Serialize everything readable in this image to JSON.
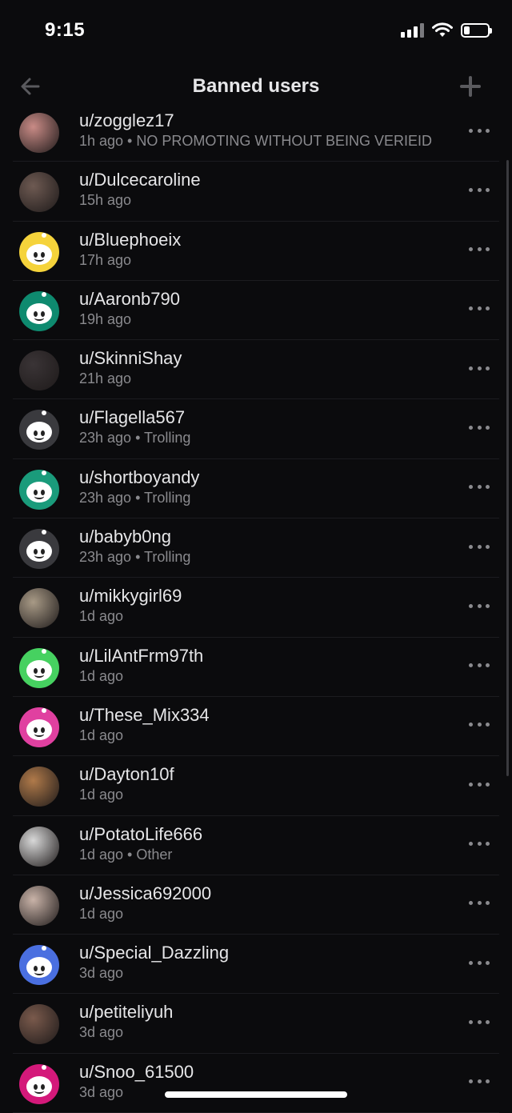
{
  "status": {
    "time": "9:15"
  },
  "header": {
    "title": "Banned users",
    "back_icon": "arrow-left-icon",
    "add_icon": "plus-icon"
  },
  "users": [
    {
      "name": "u/zogglez17",
      "meta": "1h ago • NO PROMOTING WITHOUT BEING VERIEID",
      "avatar": "photo",
      "color": "#c98b86"
    },
    {
      "name": "u/Dulcecaroline",
      "meta": "15h ago",
      "avatar": "photo",
      "color": "#6e5a52"
    },
    {
      "name": "u/Bluephoeix",
      "meta": "17h ago",
      "avatar": "snoo",
      "color": "#f5d33b"
    },
    {
      "name": "u/Aaronb790",
      "meta": "19h ago",
      "avatar": "snoo",
      "color": "#0e8a6f"
    },
    {
      "name": "u/SkinniShay",
      "meta": "21h ago",
      "avatar": "photo",
      "color": "#3a3436"
    },
    {
      "name": "u/Flagella567",
      "meta": "23h ago • Trolling",
      "avatar": "snoo",
      "color": "#3a3a3e"
    },
    {
      "name": "u/shortboyandy",
      "meta": "23h ago • Trolling",
      "avatar": "snoo",
      "color": "#1a9b7b"
    },
    {
      "name": "u/babyb0ng",
      "meta": "23h ago • Trolling",
      "avatar": "snoo",
      "color": "#3a3a3e"
    },
    {
      "name": "u/mikkygirl69",
      "meta": "1d ago",
      "avatar": "photo",
      "color": "#a89a86"
    },
    {
      "name": "u/LilAntFrm97th",
      "meta": "1d ago",
      "avatar": "snoo",
      "color": "#46d160"
    },
    {
      "name": "u/These_Mix334",
      "meta": "1d ago",
      "avatar": "snoo",
      "color": "#e040a0"
    },
    {
      "name": "u/Dayton10f",
      "meta": "1d ago",
      "avatar": "photo",
      "color": "#b07a4a"
    },
    {
      "name": "u/PotatoLife666",
      "meta": "1d ago • Other",
      "avatar": "photo",
      "color": "#d8d8d8"
    },
    {
      "name": "u/Jessica692000",
      "meta": "1d ago",
      "avatar": "photo",
      "color": "#c9b3a8"
    },
    {
      "name": "u/Special_Dazzling",
      "meta": "3d ago",
      "avatar": "snoo",
      "color": "#4a6fe0"
    },
    {
      "name": "u/petiteliyuh",
      "meta": "3d ago",
      "avatar": "photo",
      "color": "#7a5a4c"
    },
    {
      "name": "u/Snoo_61500",
      "meta": "3d ago",
      "avatar": "snoo",
      "color": "#d4197a"
    }
  ],
  "more_icon": "more-horizontal-icon"
}
